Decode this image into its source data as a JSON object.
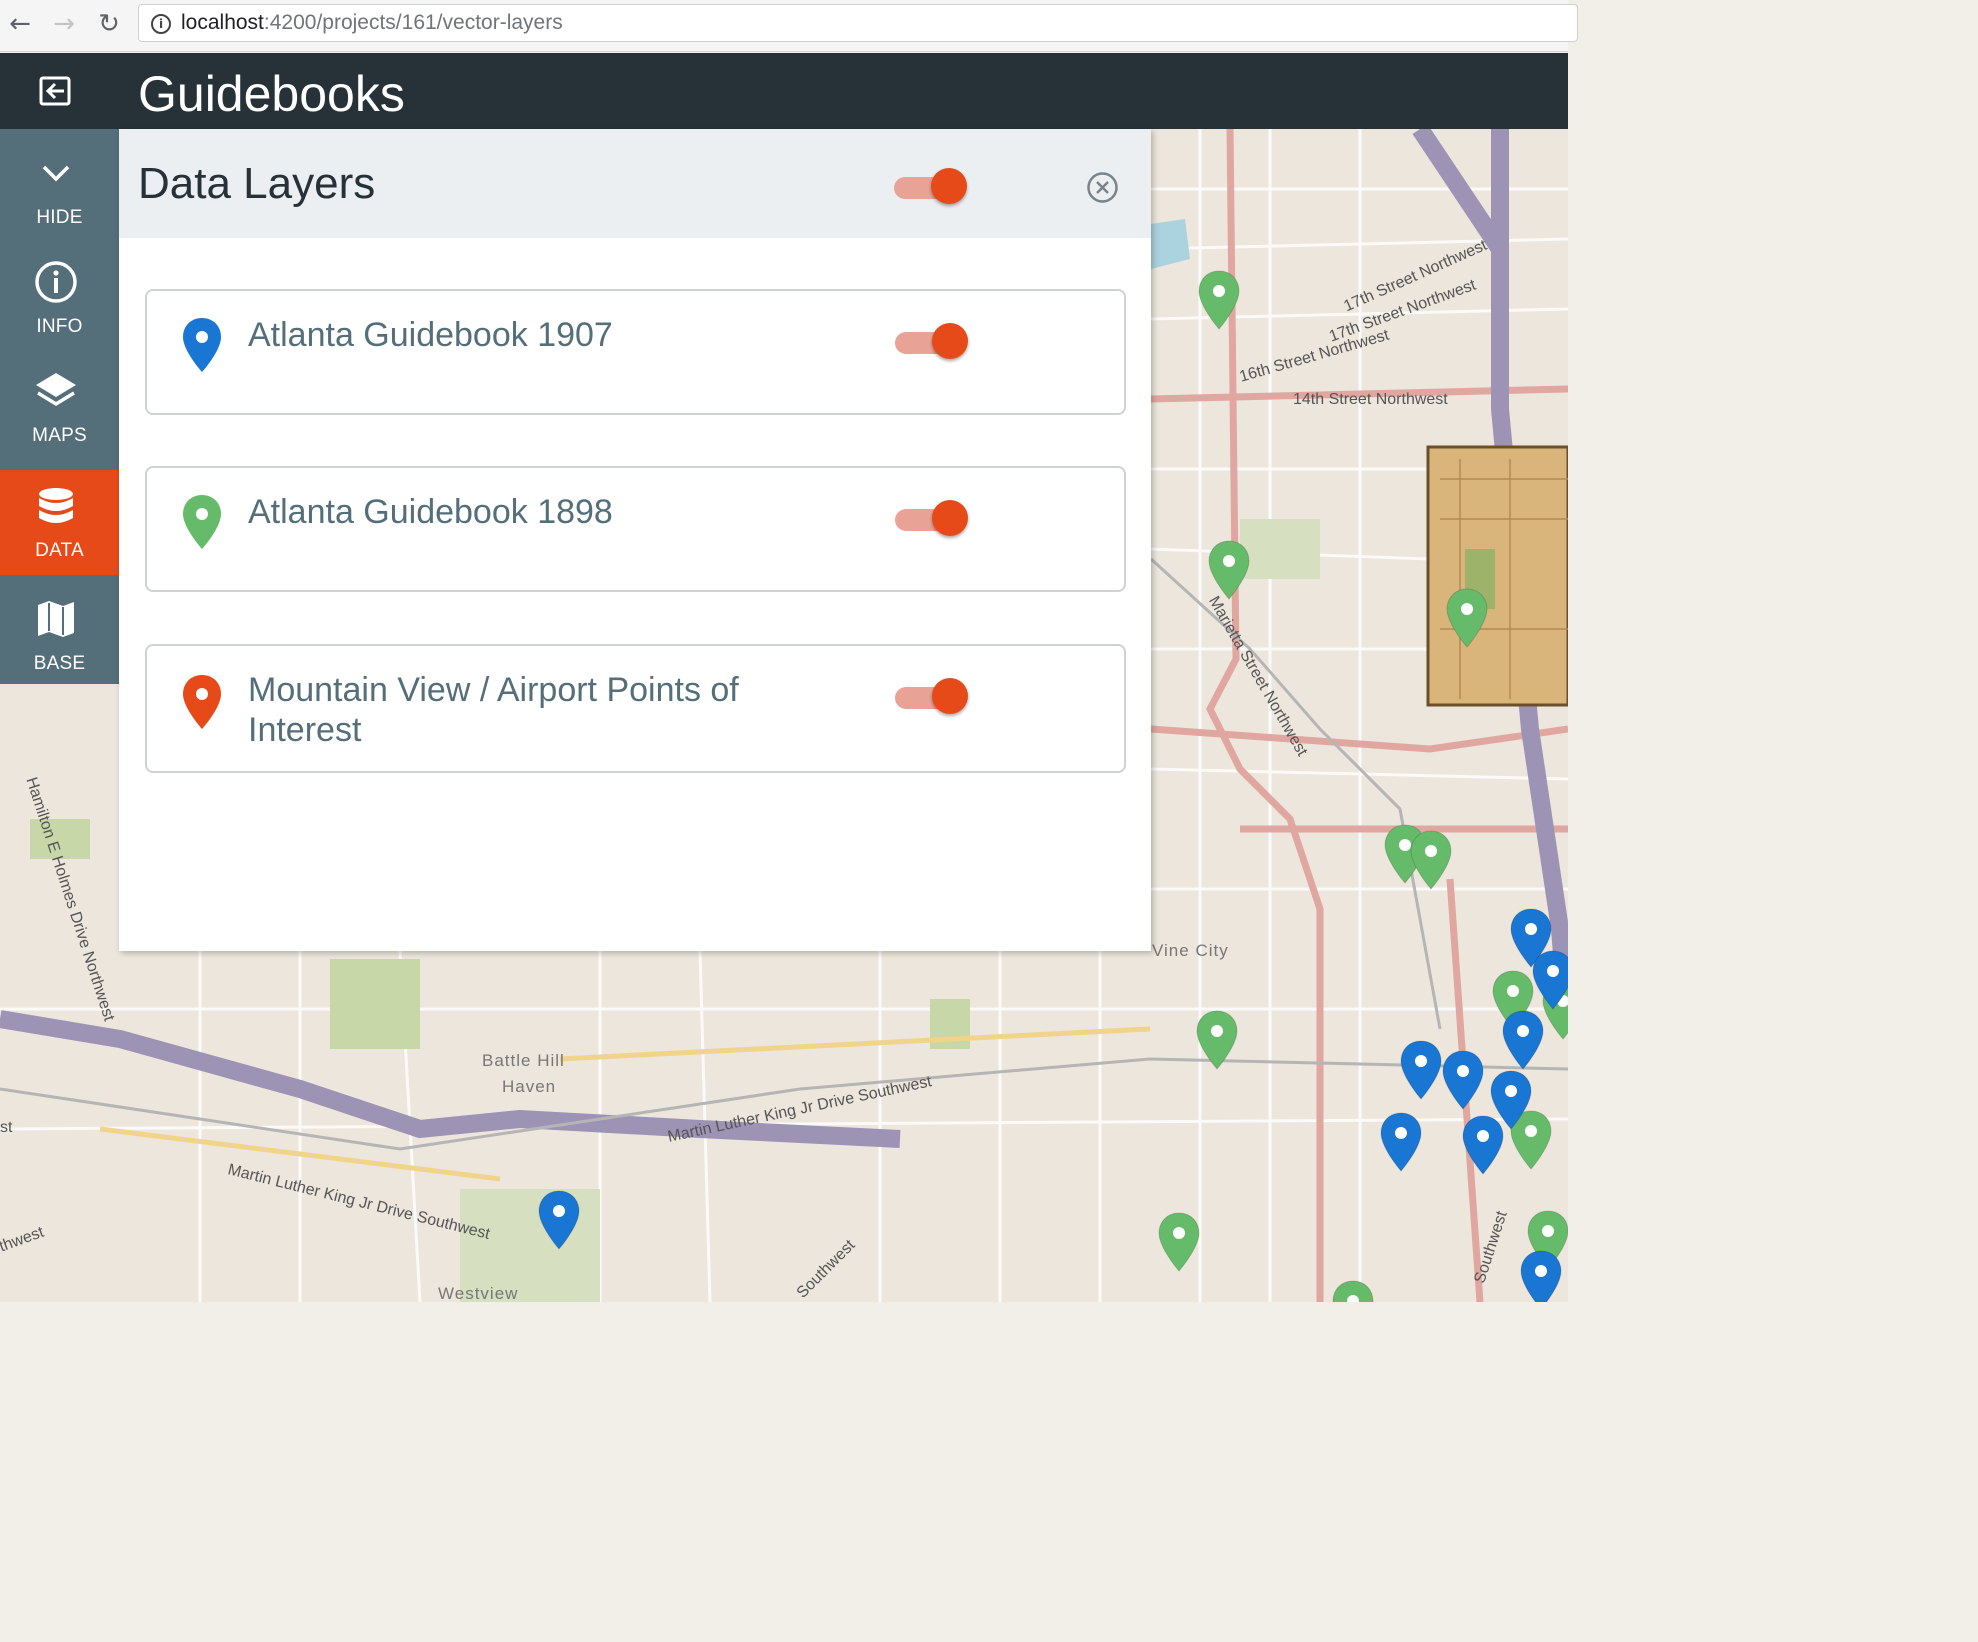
{
  "browser": {
    "back_icon": "arrow-left-icon",
    "forward_icon": "arrow-right-icon",
    "reload_icon": "reload-icon",
    "url_host": "localhost",
    "url_rest": ":4200/projects/161/vector-layers"
  },
  "header": {
    "title": "Guidebooks",
    "exit_icon": "exit-icon"
  },
  "sidebar": {
    "items": [
      {
        "label": "HIDE",
        "icon": "chevron-down-icon",
        "active": false
      },
      {
        "label": "INFO",
        "icon": "info-icon",
        "active": false
      },
      {
        "label": "MAPS",
        "icon": "layers-icon",
        "active": false
      },
      {
        "label": "DATA",
        "icon": "database-icon",
        "active": true
      },
      {
        "label": "BASE",
        "icon": "map-icon",
        "active": false
      }
    ]
  },
  "panel": {
    "title": "Data Layers",
    "master_toggle_on": true,
    "layers": [
      {
        "name": "Atlanta Guidebook 1907",
        "color": "#1976d2",
        "enabled": true
      },
      {
        "name": "Atlanta Guidebook 1898",
        "color": "#66bb6a",
        "enabled": true
      },
      {
        "name": "Mountain View / Airport Points of Interest",
        "color": "#e64a19",
        "enabled": true
      }
    ]
  },
  "map": {
    "street_labels": [
      "17th Street Northwest",
      "17th Street Northwest",
      "16th Street Northwest",
      "14th Street Northwest",
      "Marietta Street Northwest",
      "Hamilton E Holmes Drive Northwest",
      "Martin Luther King Jr Drive Southwest",
      "Martin Luther King Jr Drive Southwest",
      "thwest",
      "Southwest",
      "Southwest",
      "st"
    ],
    "place_labels": [
      "Vine City",
      "Battle Hill",
      "Haven",
      "Westview"
    ],
    "colors": {
      "blue_pin": "#1976d2",
      "green_pin": "#66bb6a",
      "accent": "#e64a19"
    }
  }
}
